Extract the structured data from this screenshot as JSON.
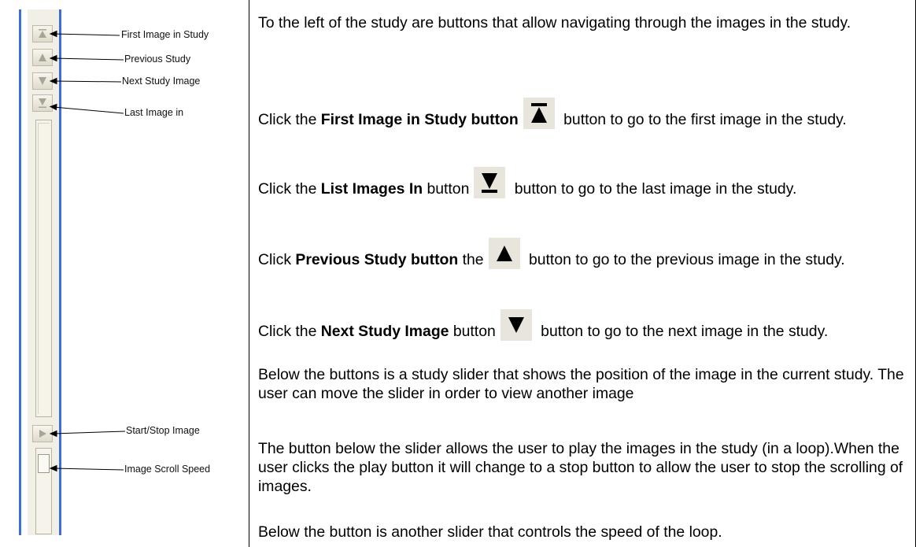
{
  "left_panel": {
    "callouts": {
      "first": "First Image in Study",
      "previous": "Previous Study",
      "next": "Next Study Image",
      "last": "Last Image in",
      "play": "Start/Stop Image",
      "speed": "Image Scroll Speed"
    }
  },
  "paragraphs": {
    "intro": "To the left of the study are buttons that allow navigating through the images in the study.",
    "first": {
      "pre": "Click the ",
      "bold": "First Image in Study button",
      "post": " button to go to the first image in the study."
    },
    "last": {
      "pre": "Click the ",
      "bold": "List Images In",
      "mid": " button",
      "post": " button to go to the last image in the study."
    },
    "previous": {
      "pre": "Click ",
      "bold": "Previous Study button",
      "mid": " the",
      "post": " button to go to the previous image in the study."
    },
    "next": {
      "pre": "Click the ",
      "bold": "Next Study Image",
      "mid": " button",
      "post": " button to go to the next image in the study."
    },
    "slider": "Below the buttons is a study slider that shows the position of the image in the current study. The user can move the slider in order to view another image",
    "play": "The button below the slider allows the user to play the images in the study (in a loop).When the user clicks the play button it will change to a stop button to allow the user to stop the scrolling of images.",
    "speed": "Below the button is another slider that controls the speed of the loop."
  },
  "colors": {
    "accent_blue": "#3a6ed8",
    "panel_bg": "#f2f0e6"
  },
  "icons": [
    "first-image-icon",
    "previous-icon",
    "next-icon",
    "last-image-icon",
    "play-icon"
  ]
}
